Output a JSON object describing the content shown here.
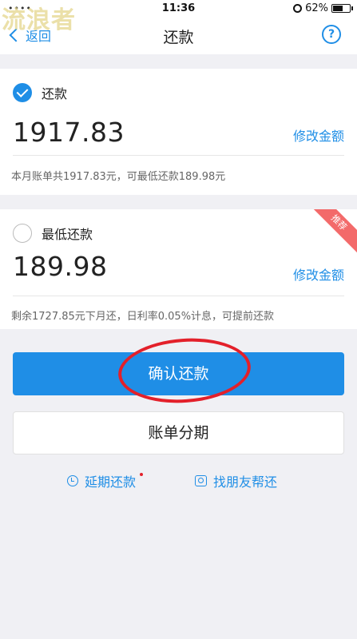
{
  "watermark": "流浪者",
  "status_bar": {
    "signal": "•••• ",
    "time": "11:36",
    "battery": "62%",
    "battery_level": 0.62
  },
  "nav": {
    "back_label": "返回",
    "title": "还款",
    "help_symbol": "?"
  },
  "options": [
    {
      "label": "还款",
      "selected": true,
      "amount": "1917.83",
      "edit_label": "修改金额",
      "note": "本月账单共1917.83元，可最低还款189.98元"
    },
    {
      "label": "最低还款",
      "selected": false,
      "amount": "189.98",
      "edit_label": "修改金额",
      "note": "剩余1727.85元下月还，日利率0.05%计息，可提前还款",
      "badge": "推荐"
    }
  ],
  "buttons": {
    "confirm": "确认还款",
    "installment": "账单分期"
  },
  "links": {
    "defer": "延期还款",
    "friend_help": "找朋友帮还"
  },
  "colors": {
    "accent": "#1f8ee6",
    "badge": "#f36a6a",
    "annotation": "#e3202a"
  }
}
